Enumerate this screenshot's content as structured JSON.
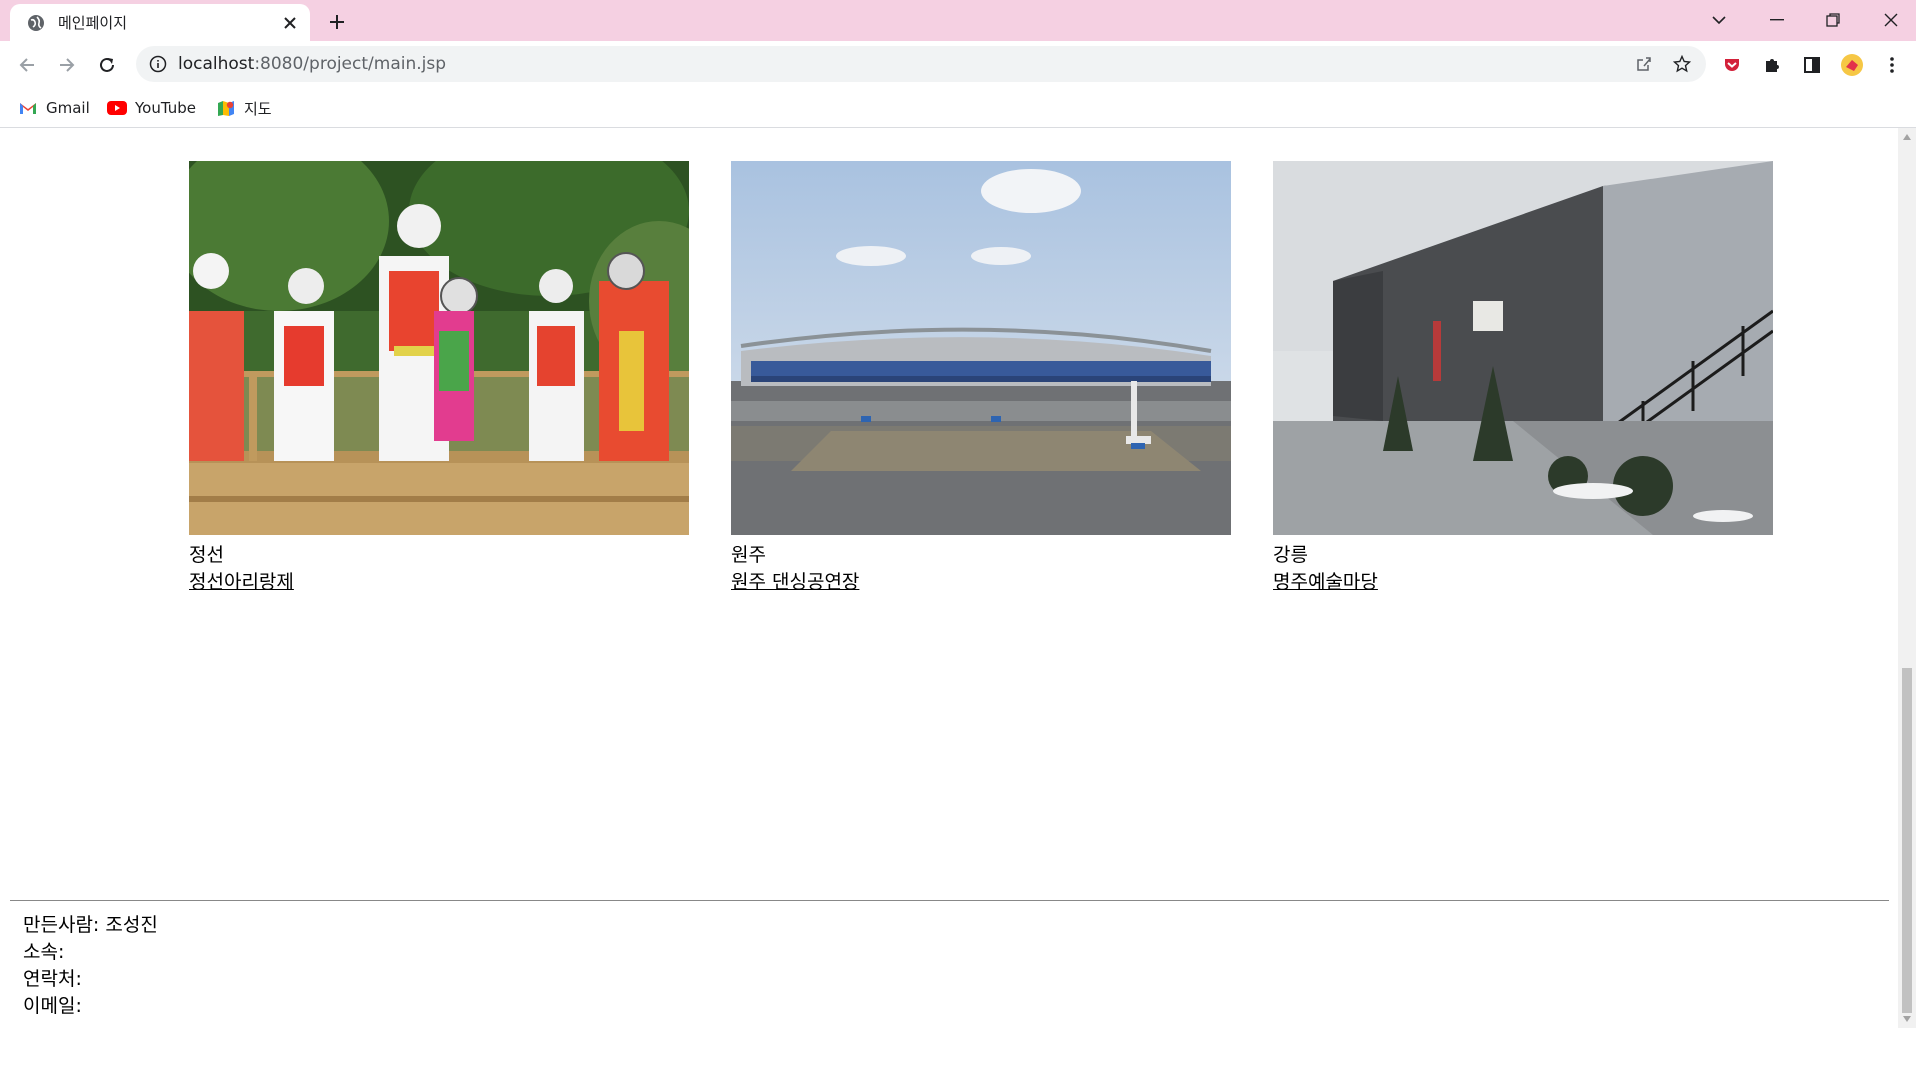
{
  "browser": {
    "tab_title": "메인페이지",
    "url_host": "localhost",
    "url_rest": ":8080/project/main.jsp",
    "bookmarks": [
      {
        "label": "Gmail",
        "icon": "gmail-icon"
      },
      {
        "label": "YouTube",
        "icon": "youtube-icon"
      },
      {
        "label": "지도",
        "icon": "maps-icon"
      }
    ]
  },
  "cards": [
    {
      "city": "정선",
      "link": "정선아리랑제",
      "image": "folk-dancers-photo"
    },
    {
      "city": "원주",
      "link": "원주 댄싱공연장",
      "image": "stadium-plaza-photo"
    },
    {
      "city": "강릉",
      "link": "명주예술마당",
      "image": "arts-building-photo"
    }
  ],
  "footer": {
    "maker_label": "만든사람:",
    "maker_value": "조성진",
    "affiliation_label": "소속:",
    "contact_label": "연락처:",
    "email_label": "이메일:"
  },
  "colors": {
    "tabbar": "#f5d0e2",
    "omnibox": "#f1f3f4",
    "text": "#000000"
  }
}
